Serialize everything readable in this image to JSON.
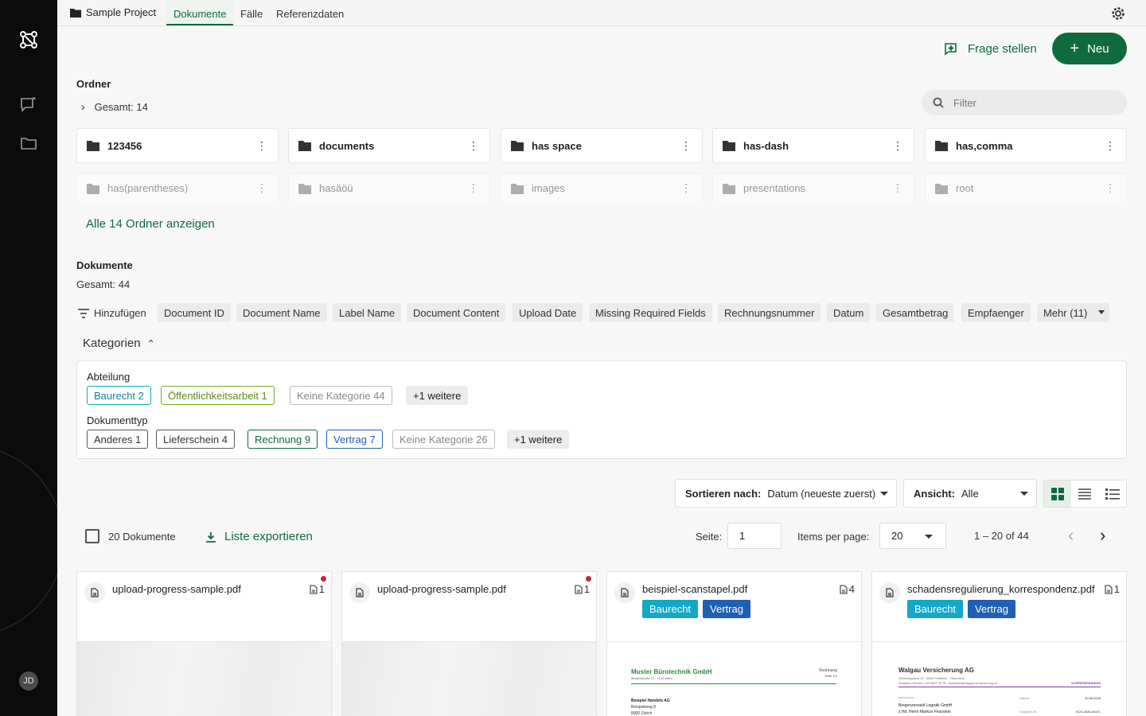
{
  "topbar": {
    "project": "Sample Project",
    "tabs": [
      "Dokumente",
      "Fälle",
      "Referenzdaten"
    ]
  },
  "actions": {
    "ask": "Frage stellen",
    "new": "Neu"
  },
  "folders": {
    "title": "Ordner",
    "total": "Gesamt: 14",
    "filter_placeholder": "Filter",
    "items": [
      "123456",
      "documents",
      "has space",
      "has-dash",
      "has,comma"
    ],
    "faded_items": [
      "has(parentheses)",
      "hasäöü",
      "images",
      "presentations",
      "root"
    ],
    "show_all": "Alle 14 Ordner anzeigen"
  },
  "documents": {
    "title": "Dokumente",
    "total": "Gesamt: 44",
    "add_filter": "Hinzufügen",
    "filter_chips": [
      "Document ID",
      "Document Name",
      "Label Name",
      "Document Content",
      "Upload Date",
      "Missing Required Fields",
      "Rechnungsnummer",
      "Datum",
      "Gesamtbetrag",
      "Empfaenger",
      "Mehr (11)"
    ],
    "categories_toggle": "Kategorien",
    "groups": [
      {
        "name": "Abteilung",
        "tags": [
          "Baurecht 2",
          "Öffentlichkeitsarbeit 1",
          "Keine Kategorie 44",
          "+1 weitere"
        ]
      },
      {
        "name": "Dokumenttyp",
        "tags": [
          "Anderes 1",
          "Lieferschein 4",
          "Rechnung 9",
          "Vertrag 7",
          "Keine Kategorie 26",
          "+1 weitere"
        ]
      }
    ],
    "sort_label": "Sortieren nach:",
    "sort_value": "Datum (neueste zuerst)",
    "view_label": "Ansicht:",
    "view_value": "Alle",
    "select_count": "20 Dokumente",
    "export": "Liste exportieren",
    "page_label": "Seite:",
    "page_value": "1",
    "per_page_label": "Items per page:",
    "per_page_value": "20",
    "range": "1 – 20 of 44"
  },
  "cards": [
    {
      "name": "upload-progress-sample.pdf",
      "count": "1",
      "labels": []
    },
    {
      "name": "upload-progress-sample.pdf",
      "count": "1",
      "labels": []
    },
    {
      "name": "beispiel-scanstapel.pdf",
      "count": "4",
      "labels": [
        "Baurecht",
        "Vertrag"
      ]
    },
    {
      "name": "schadensregulierung_korrespondenz.pdf",
      "count": "1",
      "labels": [
        "Baurecht",
        "Vertrag"
      ]
    }
  ],
  "previews": {
    "p3_company": "Muster Bürotechnik GmbH",
    "p3_addr": "Musterstraße 12 · 1010 Wien",
    "p3_doc": "Rechnung",
    "p3_page": "Seite 1/1",
    "p3_to1": "Beispiel Handels AG",
    "p3_to2": "Beispielweg 8",
    "p3_to3": "8000 Zürich",
    "p4_company": "Walgau Versicherung AG",
    "p4_addr": "Schmelzgasse 12 · 6800 Feldkirch · Österreich",
    "p4_svc": "Schaden-Service +43 5522 78 78 · schaden@walgau-versicherung.at",
    "p4_kind": "KORRESPONDENZ",
    "p4_recv_label": "EMPFÄNGER",
    "p4_date_label": "Datum",
    "p4_date": "20.06.2026",
    "p4_to1": "Bregenzerwald Logistik GmbH",
    "p4_to2": "z.Hd. Herrn Markus Feurstein",
    "p4_ref_label": "Schaden-Nr.",
    "p4_ref": "SCH-2026-04471"
  },
  "user": {
    "initials": "JD"
  },
  "colors": {
    "accent": "#0f6b3d",
    "baurecht": "#13a8c7",
    "vertrag": "#1f5fb4"
  }
}
